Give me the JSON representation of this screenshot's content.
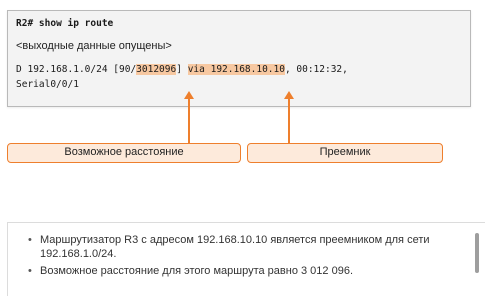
{
  "terminal": {
    "prompt": "R2#",
    "command": "show ip route",
    "omitted": "<выходные данные опущены>",
    "route": {
      "code": "D",
      "network": "192.168.1.0/24",
      "bracket_open": "[90/",
      "feasible_distance": "3012096",
      "bracket_close": "]",
      "via_label": "via",
      "next_hop": "192.168.10.10",
      "age": ", 00:12:32,",
      "interface": "Serial0/0/1"
    }
  },
  "callouts": {
    "feasible_distance_label": "Возможное расстояние",
    "successor_label": "Преемник"
  },
  "notes": [
    "Маршрутизатор R3 с адресом 192.168.10.10 является преемником для сети 192.168.1.0/24.",
    "Возможное расстояние для этого маршрута равно 3 012 096."
  ],
  "colors": {
    "accent": "#ee7f2d",
    "highlight": "#f7c8a1",
    "callout_fill": "#fdeadb",
    "terminal_bg": "#f3f3f3"
  },
  "icons": {
    "arrows": "up-arrow-icon"
  }
}
